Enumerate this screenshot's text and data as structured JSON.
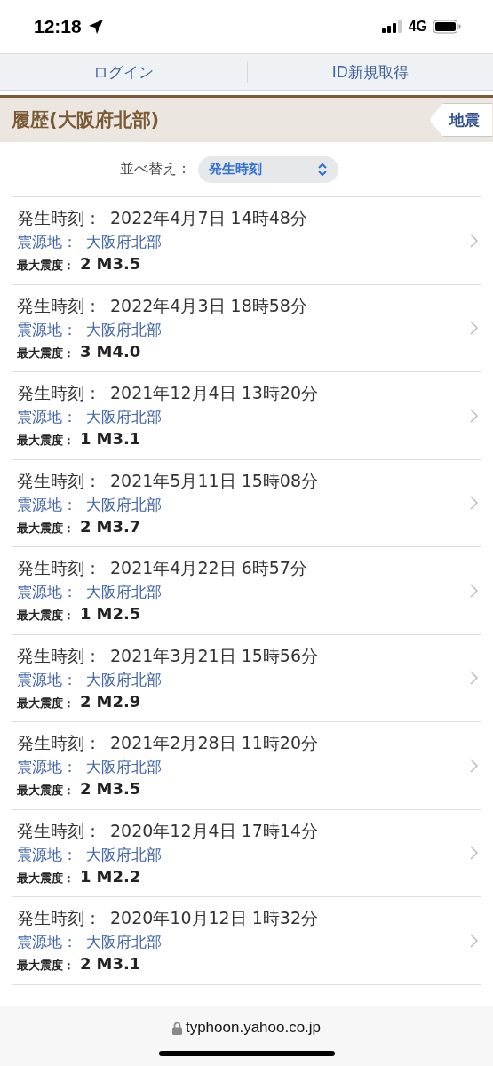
{
  "status_bar": {
    "time": "12:18",
    "network": "4G"
  },
  "nav": [
    {
      "label": "ログイン"
    },
    {
      "label": "ID新規取得"
    }
  ],
  "header": {
    "title": "履歴(大阪府北部)",
    "back_button": "地震"
  },
  "sort": {
    "label": "並べ替え：",
    "value": "発生時刻"
  },
  "rows": [
    {
      "time_label": "発生時刻：",
      "time": "2022年4月7日 14時48分",
      "epicenter_label": "震源地：",
      "epicenter": "大阪府北部",
      "intensity_label": "最大震度：",
      "intensity": "2",
      "magnitude": "M3.5"
    },
    {
      "time_label": "発生時刻：",
      "time": "2022年4月3日 18時58分",
      "epicenter_label": "震源地：",
      "epicenter": "大阪府北部",
      "intensity_label": "最大震度：",
      "intensity": "3",
      "magnitude": "M4.0"
    },
    {
      "time_label": "発生時刻：",
      "time": "2021年12月4日 13時20分",
      "epicenter_label": "震源地：",
      "epicenter": "大阪府北部",
      "intensity_label": "最大震度：",
      "intensity": "1",
      "magnitude": "M3.1"
    },
    {
      "time_label": "発生時刻：",
      "time": "2021年5月11日 15時08分",
      "epicenter_label": "震源地：",
      "epicenter": "大阪府北部",
      "intensity_label": "最大震度：",
      "intensity": "2",
      "magnitude": "M3.7"
    },
    {
      "time_label": "発生時刻：",
      "time": "2021年4月22日 6時57分",
      "epicenter_label": "震源地：",
      "epicenter": "大阪府北部",
      "intensity_label": "最大震度：",
      "intensity": "1",
      "magnitude": "M2.5"
    },
    {
      "time_label": "発生時刻：",
      "time": "2021年3月21日 15時56分",
      "epicenter_label": "震源地：",
      "epicenter": "大阪府北部",
      "intensity_label": "最大震度：",
      "intensity": "2",
      "magnitude": "M2.9"
    },
    {
      "time_label": "発生時刻：",
      "time": "2021年2月28日 11時20分",
      "epicenter_label": "震源地：",
      "epicenter": "大阪府北部",
      "intensity_label": "最大震度：",
      "intensity": "2",
      "magnitude": "M3.5"
    },
    {
      "time_label": "発生時刻：",
      "time": "2020年12月4日 17時14分",
      "epicenter_label": "震源地：",
      "epicenter": "大阪府北部",
      "intensity_label": "最大震度：",
      "intensity": "1",
      "magnitude": "M2.2"
    },
    {
      "time_label": "発生時刻：",
      "time": "2020年10月12日 1時32分",
      "epicenter_label": "震源地：",
      "epicenter": "大阪府北部",
      "intensity_label": "最大震度：",
      "intensity": "2",
      "magnitude": "M3.1"
    }
  ],
  "address_bar": {
    "url": "typhoon.yahoo.co.jp"
  }
}
